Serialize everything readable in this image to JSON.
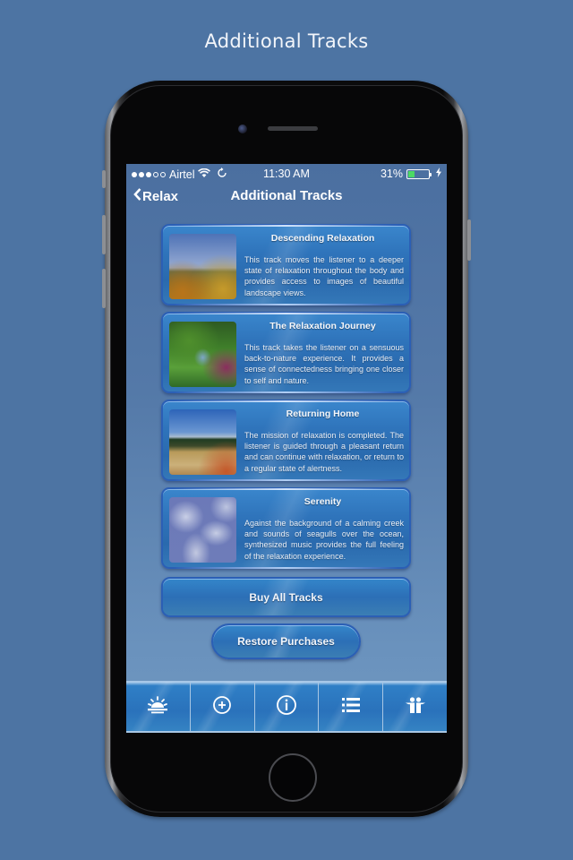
{
  "page": {
    "heading": "Additional Tracks",
    "background_color": "#4d74a3"
  },
  "status_bar": {
    "signal_dots_filled": 3,
    "signal_dots_total": 5,
    "carrier": "Airtel",
    "wifi_icon": "wifi-icon",
    "sync_icon": "sync-icon",
    "time": "11:30 AM",
    "battery_percent_label": "31%",
    "battery_level": 0.31,
    "battery_fill_color": "#4cd964",
    "charging_icon": "bolt-icon"
  },
  "nav": {
    "back_label": "Relax",
    "back_icon": "chevron-left-icon",
    "title": "Additional Tracks"
  },
  "tracks": [
    {
      "title": "Descending Relaxation",
      "description": "This track moves the listener to a deeper state of relaxation throughout the body and provides access to images of beautiful landscape views.",
      "thumbnail": "autumn-valley-landscape"
    },
    {
      "title": "The Relaxation Journey",
      "description": "This track takes the listener on a sensuous back-to-nature experience. It provides a sense of connectedness bringing one closer to self and nature.",
      "thumbnail": "garden-waterfall"
    },
    {
      "title": "Returning Home",
      "description": "The mission of relaxation is completed. The listener is guided through a pleasant return and can continue with relaxation, or return to a regular state of alertness.",
      "thumbnail": "meadow-path-hills"
    },
    {
      "title": "Serenity",
      "description": "Against the background of a calming creek and sounds of seagulls over the ocean, synthesized music provides the full feeling of the relaxation experience.",
      "thumbnail": "cloudy-sky"
    }
  ],
  "buttons": {
    "buy_all": "Buy All Tracks",
    "restore": "Restore Purchases"
  },
  "tab_bar": {
    "tabs": [
      {
        "icon": "sunrise-icon",
        "name": "relax"
      },
      {
        "icon": "plus-circle-icon",
        "name": "additional-tracks"
      },
      {
        "icon": "info-circle-icon",
        "name": "info"
      },
      {
        "icon": "list-icon",
        "name": "list"
      },
      {
        "icon": "people-icon",
        "name": "share"
      }
    ]
  }
}
